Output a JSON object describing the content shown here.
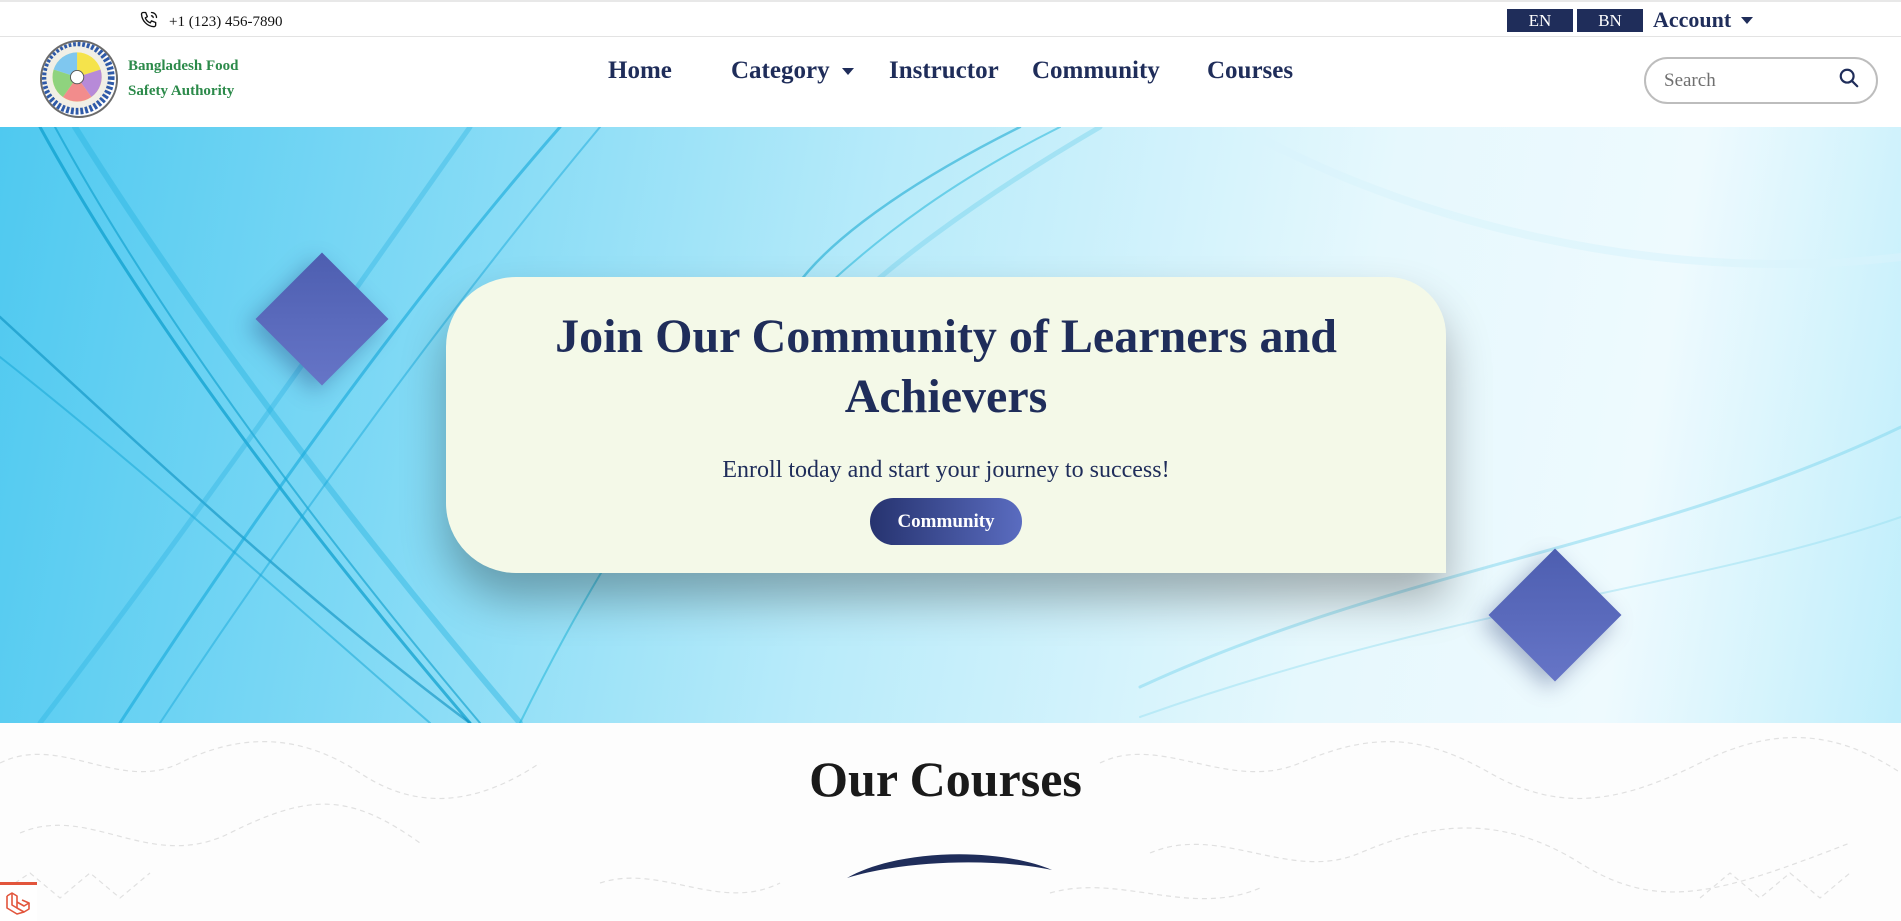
{
  "topbar": {
    "phone_icon": "phone-icon",
    "phone": "+1 (123) 456-7890",
    "lang_en": "EN",
    "lang_bn": "BN",
    "account_label": "Account"
  },
  "navbar": {
    "brand_line1": "Bangladesh Food",
    "brand_line2": "Safety Authority",
    "items": [
      {
        "label": "Home"
      },
      {
        "label": "Category"
      },
      {
        "label": "Instructor"
      },
      {
        "label": "Community"
      },
      {
        "label": "Courses"
      }
    ],
    "search_placeholder": "Search",
    "search_icon": "search-icon"
  },
  "hero": {
    "title": "Join Our Community of Learners and Achievers",
    "subtitle": "Enroll today and start your journey to success!",
    "button_label": "Community"
  },
  "courses": {
    "title": "Our Courses"
  },
  "colors": {
    "navy": "#1f2d5a",
    "brand_green": "#2c8a4a",
    "card_bg": "#f4f9e8",
    "diamond": "#5565b9",
    "hero_cyan": "#4fc9f0"
  }
}
